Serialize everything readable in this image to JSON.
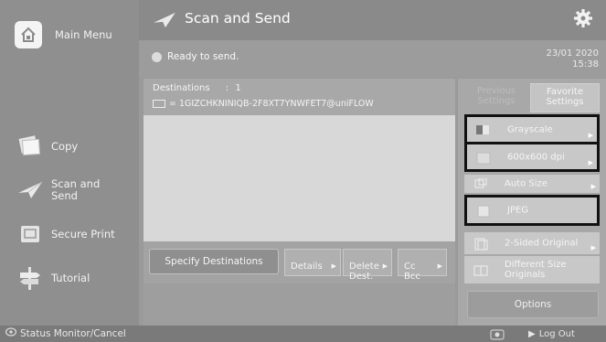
{
  "sidebar": {
    "main_menu": "Main Menu",
    "items": [
      {
        "label": "Copy",
        "icon": "copy-icon"
      },
      {
        "label": "Scan and\nSend",
        "icon": "scan-send-icon"
      },
      {
        "label": "Secure Print",
        "icon": "secure-print-icon"
      },
      {
        "label": "Tutorial",
        "icon": "tutorial-icon"
      }
    ],
    "status_monitor": "Status Monitor/Cancel"
  },
  "header": {
    "title": "Scan and Send",
    "status": "Ready to send.",
    "date": "23/01 2020",
    "time": "15:38"
  },
  "destinations": {
    "heading": "Destinations",
    "separator": ":",
    "count": "1",
    "entry": "= 1GIZCHKNINIQB-2F8XT7YNWFET7@uniFLOW"
  },
  "buttons": {
    "specify": "Specify Destinations",
    "details": "Details",
    "delete": "Delete\nDest.",
    "ccbcc": "Cc\nBcc"
  },
  "settings": {
    "tab_previous": "Previous\nSettings",
    "tab_favorite": "Favorite\nSettings",
    "items": [
      {
        "label": "Grayscale",
        "icon": "color-mode-icon"
      },
      {
        "label": "600x600 dpi",
        "icon": "resolution-icon"
      },
      {
        "label": "Auto Size",
        "icon": "auto-size-icon"
      },
      {
        "label": "JPEG",
        "icon": "file-format-icon"
      },
      {
        "label": "2-Sided Original",
        "icon": "two-sided-icon"
      },
      {
        "label": "Different Size\nOriginals",
        "icon": "different-size-icon"
      }
    ],
    "options": "Options"
  },
  "footer": {
    "logout": "Log Out"
  }
}
